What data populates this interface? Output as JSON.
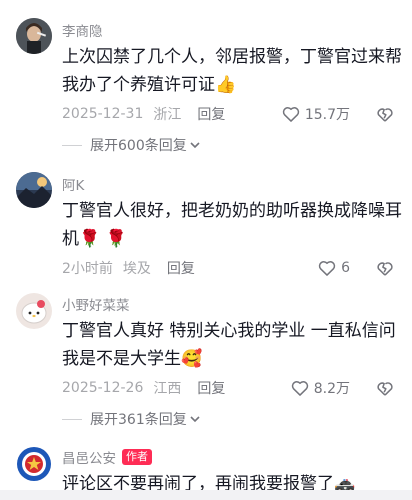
{
  "comments": [
    {
      "username": "李商隐",
      "text": "上次囚禁了几个人，邻居报警，丁警官过来帮我办了个养殖许可证",
      "emoji": "👍",
      "date": "2025-12-31",
      "location": "浙江",
      "reply_label": "回复",
      "likes": "15.7万",
      "expand_label": "展开600条回复",
      "avatar_icon": "person-avatar-icon"
    },
    {
      "username": "阿K",
      "text": "丁警官人很好，把老奶奶的助听器换成降噪耳机",
      "emoji": "🌹 🌹",
      "date": "2小时前",
      "location": "埃及",
      "reply_label": "回复",
      "likes": "6",
      "avatar_icon": "landscape-avatar-icon"
    },
    {
      "username": "小野好菜菜",
      "text": "丁警官人真好 特别关心我的学业 一直私信问我是不是大学生",
      "emoji": "🥰",
      "date": "2025-12-26",
      "location": "江西",
      "reply_label": "回复",
      "likes": "8.2万",
      "expand_label": "展开361条回复",
      "avatar_icon": "cartoon-cat-avatar-icon"
    },
    {
      "username": "昌邑公安",
      "author_badge": "作者",
      "text": "评论区不要再闹了，再闹我要报警了",
      "emoji": "🚓",
      "avatar_icon": "police-badge-avatar-icon"
    }
  ],
  "colors": {
    "text": "#161823",
    "muted": "#a6a7ab",
    "badge": "#fe2c55"
  }
}
